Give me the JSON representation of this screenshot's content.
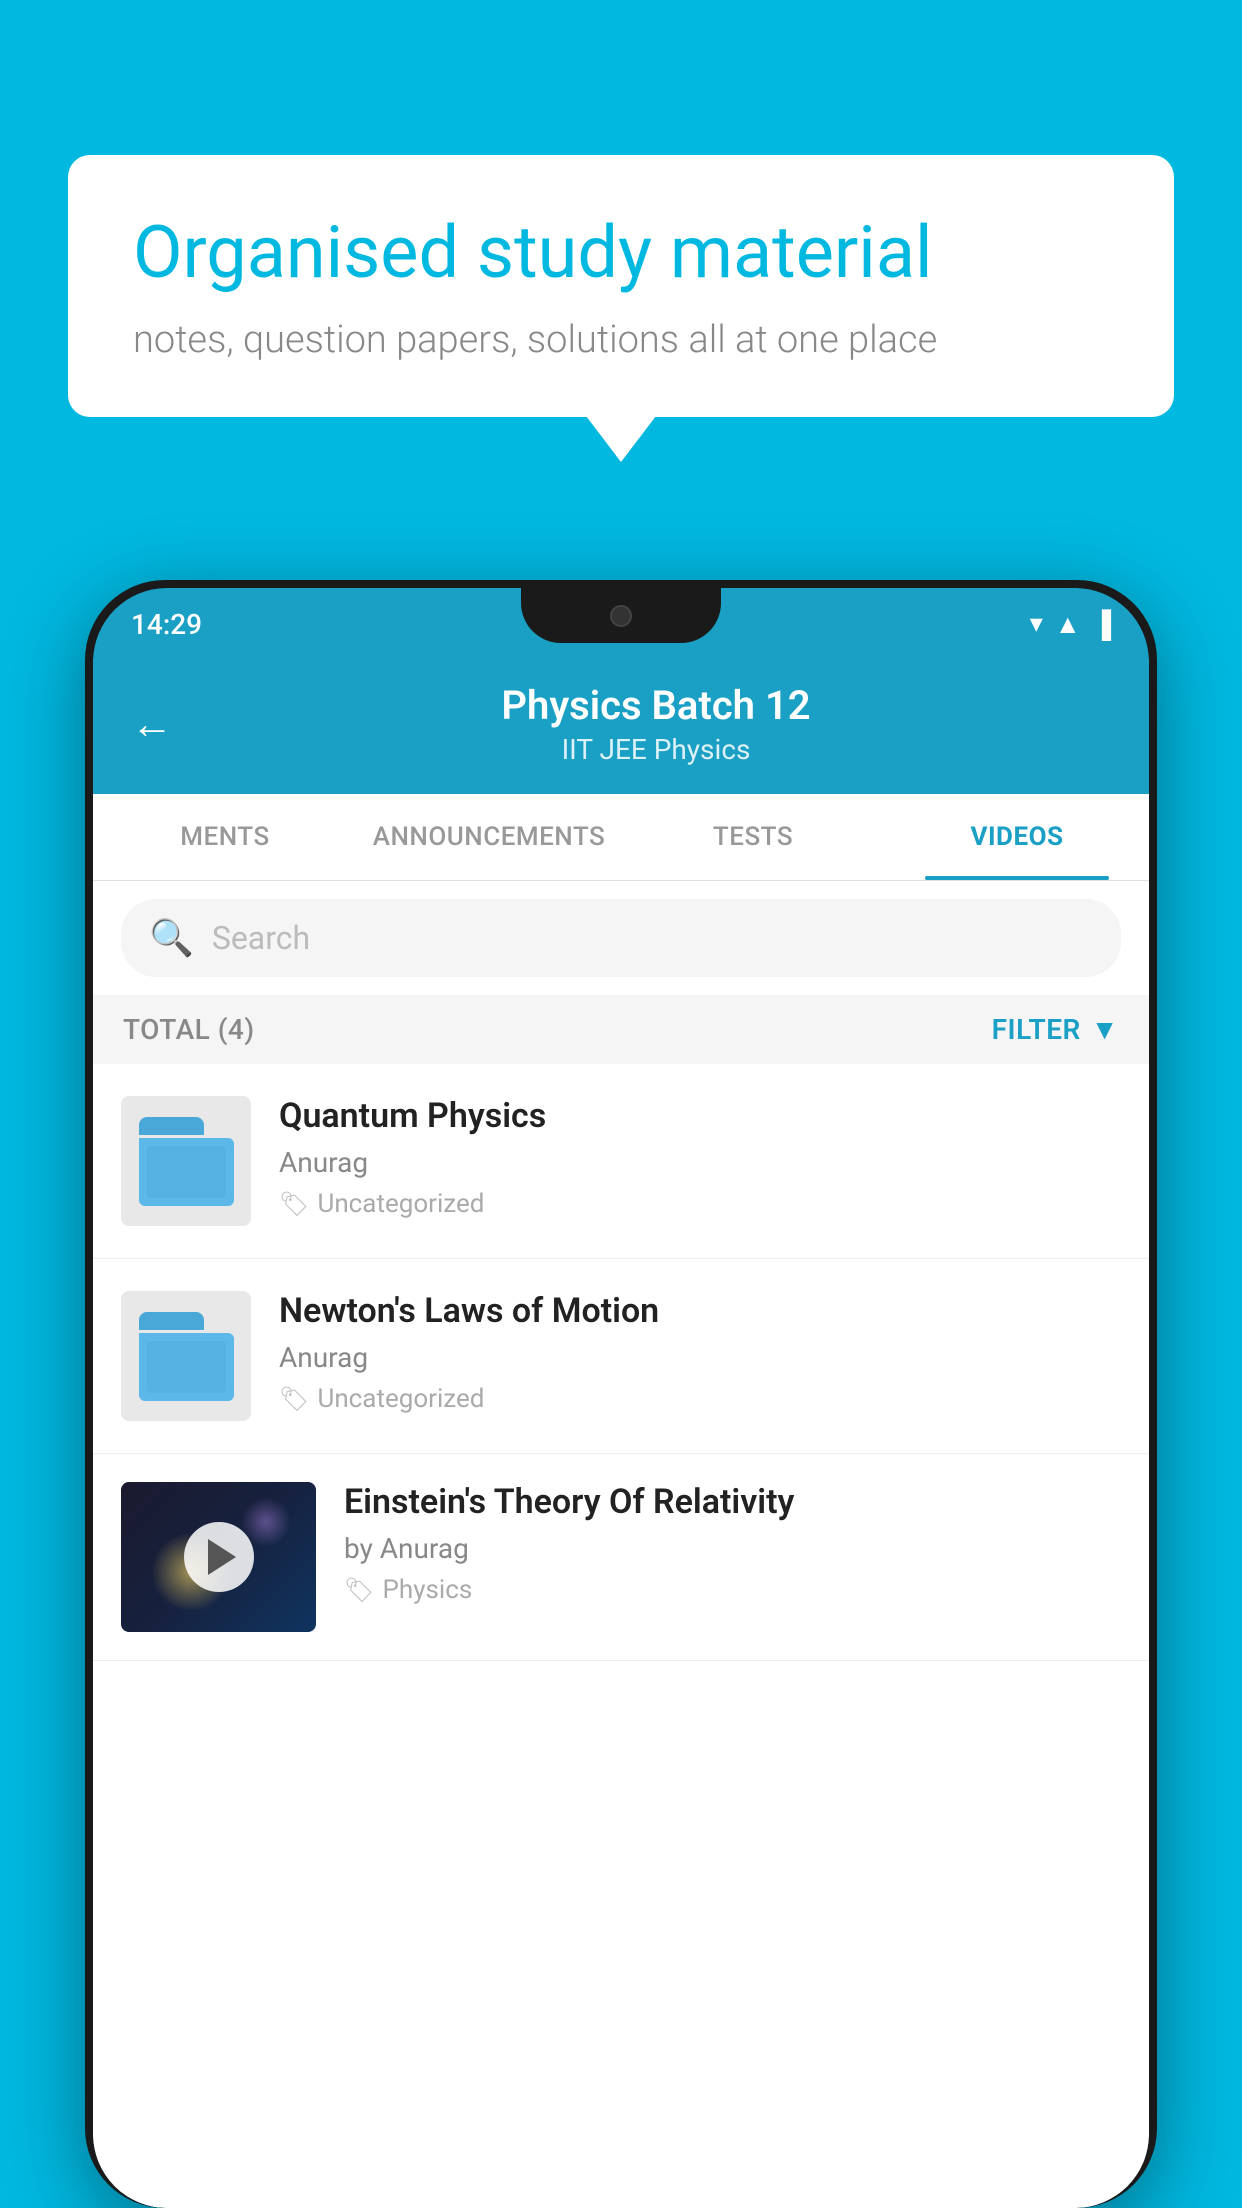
{
  "background_color": "#00B8E0",
  "speech_bubble": {
    "heading": "Organised study material",
    "subtext": "notes, question papers, solutions all at one place"
  },
  "status_bar": {
    "time": "14:29",
    "icons": [
      "▾",
      "◀",
      "▐"
    ]
  },
  "app_header": {
    "title": "Physics Batch 12",
    "subtitle": "IIT JEE   Physics",
    "back_label": "←"
  },
  "tabs": [
    {
      "label": "MENTS",
      "active": false
    },
    {
      "label": "ANNOUNCEMENTS",
      "active": false
    },
    {
      "label": "TESTS",
      "active": false
    },
    {
      "label": "VIDEOS",
      "active": true
    }
  ],
  "search": {
    "placeholder": "Search"
  },
  "filter_bar": {
    "total_label": "TOTAL (4)",
    "filter_label": "FILTER"
  },
  "videos": [
    {
      "title": "Quantum Physics",
      "author": "Anurag",
      "tag": "Uncategorized",
      "has_thumbnail": false
    },
    {
      "title": "Newton's Laws of Motion",
      "author": "Anurag",
      "tag": "Uncategorized",
      "has_thumbnail": false
    },
    {
      "title": "Einstein's Theory Of Relativity",
      "author": "by Anurag",
      "tag": "Physics",
      "has_thumbnail": true
    }
  ]
}
